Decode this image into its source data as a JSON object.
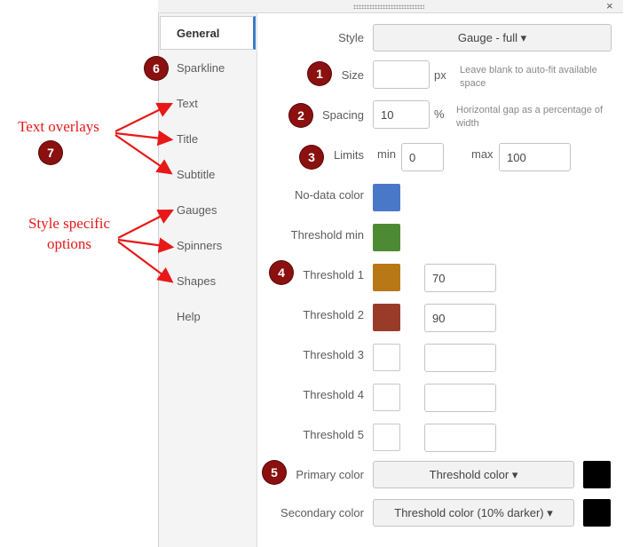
{
  "window": {
    "close_glyph": "×"
  },
  "sidebar": {
    "items": [
      {
        "label": "General"
      },
      {
        "label": "Sparkline"
      },
      {
        "label": "Text"
      },
      {
        "label": "Title"
      },
      {
        "label": "Subtitle"
      },
      {
        "label": "Gauges"
      },
      {
        "label": "Spinners"
      },
      {
        "label": "Shapes"
      },
      {
        "label": "Help"
      }
    ]
  },
  "form": {
    "style": {
      "label": "Style",
      "value": "Gauge - full ▾"
    },
    "size": {
      "label": "Size",
      "value": "",
      "unit": "px",
      "hint": "Leave blank to auto-fit available space"
    },
    "spacing": {
      "label": "Spacing",
      "value": "10",
      "unit": "%",
      "hint": "Horizontal gap as a percentage of width"
    },
    "limits": {
      "label": "Limits",
      "min_label": "min",
      "min_value": "0",
      "max_label": "max",
      "max_value": "100"
    },
    "nodata": {
      "label": "No-data color",
      "color": "#4a78c8"
    },
    "threshold_min": {
      "label": "Threshold min",
      "color": "#4e8a34"
    },
    "threshold1": {
      "label": "Threshold 1",
      "color": "#b87815",
      "value": "70"
    },
    "threshold2": {
      "label": "Threshold 2",
      "color": "#9a3b2a",
      "value": "90"
    },
    "threshold3": {
      "label": "Threshold 3",
      "value": ""
    },
    "threshold4": {
      "label": "Threshold 4",
      "value": ""
    },
    "threshold5": {
      "label": "Threshold 5",
      "value": ""
    },
    "primary_color": {
      "label": "Primary color",
      "value": "Threshold color ▾",
      "color": "#000000"
    },
    "secondary_color": {
      "label": "Secondary color",
      "value": "Threshold color (10% darker) ▾",
      "color": "#000000"
    }
  },
  "annotations": {
    "badges": [
      "1",
      "2",
      "3",
      "4",
      "5",
      "6",
      "7"
    ],
    "text_overlays": "Text overlays",
    "style_specific_line1": "Style specific",
    "style_specific_line2": "options",
    "color": "#e81818",
    "badge_color": "#8b1010"
  }
}
